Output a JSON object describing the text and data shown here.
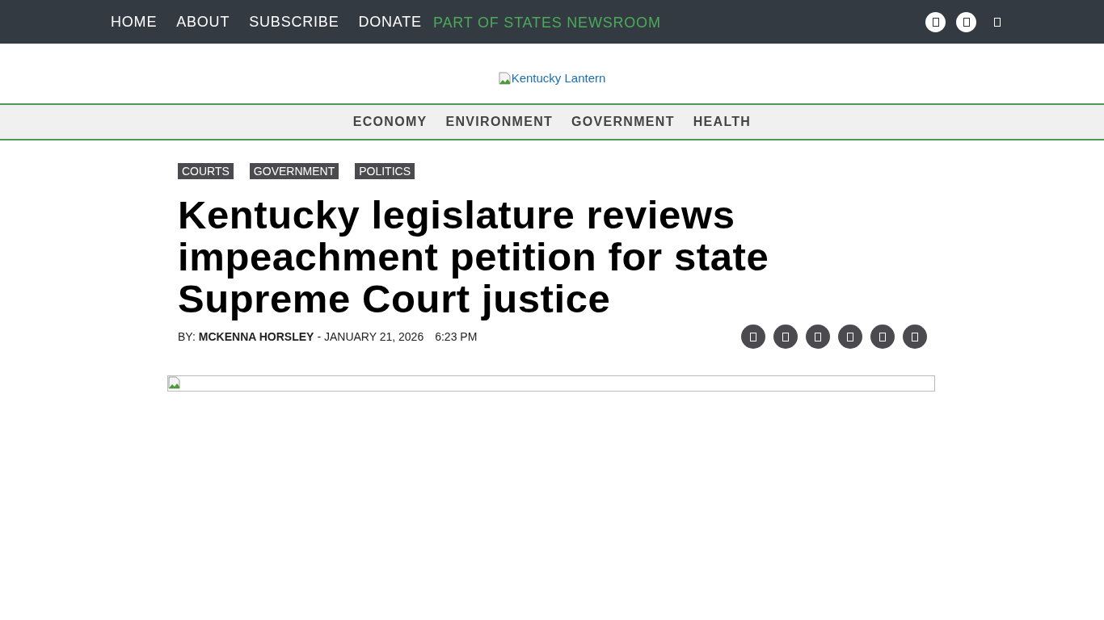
{
  "top_nav": {
    "items": [
      "HOME",
      "ABOUT",
      "SUBSCRIBE",
      "DONATE"
    ],
    "tagline": "PART OF STATES NEWSROOM"
  },
  "logo": {
    "alt": "Kentucky Lantern"
  },
  "sections": [
    "ECONOMY",
    "ENVIRONMENT",
    "GOVERNMENT",
    "HEALTH"
  ],
  "tags": [
    "COURTS",
    "GOVERNMENT",
    "POLITICS"
  ],
  "headline": "Kentucky legislature reviews impeachment petition for state Supreme Court justice",
  "byline": {
    "prefix": "BY:",
    "author": "MCKENNA HORSLEY",
    "date": "- JANUARY 21, 2026",
    "time": "6:23 PM"
  }
}
